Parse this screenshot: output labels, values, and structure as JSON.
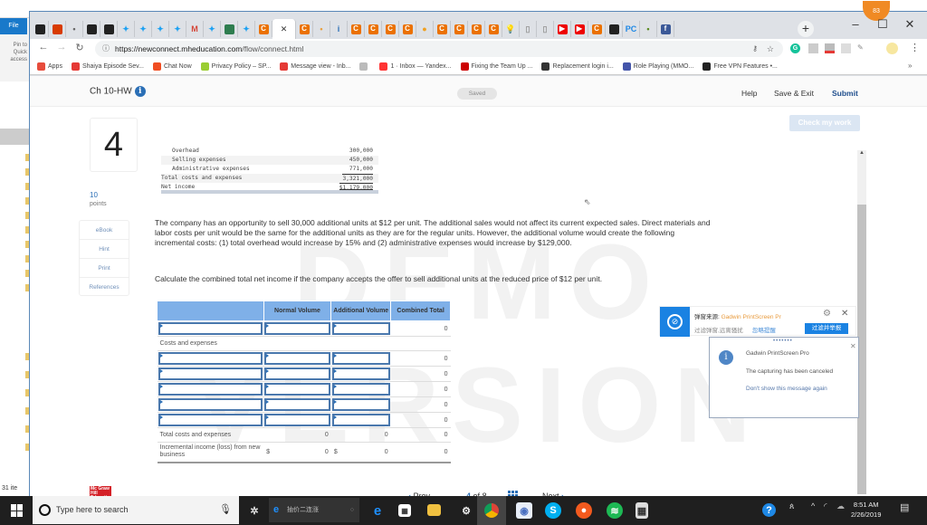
{
  "explorer": {
    "file_tab": "File",
    "pin_label": "Pin to Quick access",
    "item_count": "31 ite"
  },
  "browser": {
    "tabs": [
      {
        "icon": "film-icon",
        "color": "#222"
      },
      {
        "icon": "office-icon",
        "color": "#d83b01"
      },
      {
        "icon": "link-icon",
        "color": "#666"
      },
      {
        "icon": "qr-icon",
        "color": "#222"
      },
      {
        "icon": "tr-icon",
        "color": "#222"
      },
      {
        "icon": "twitter-icon",
        "color": "#1da1f2"
      },
      {
        "icon": "twitter-icon",
        "color": "#1da1f2"
      },
      {
        "icon": "twitter-icon",
        "color": "#1da1f2"
      },
      {
        "icon": "twitter-icon",
        "color": "#1da1f2"
      },
      {
        "icon": "gmail-icon",
        "color": "#d44638"
      },
      {
        "icon": "twitter-icon",
        "color": "#1da1f2"
      },
      {
        "icon": "green-box-icon",
        "color": "#2e7d4f"
      },
      {
        "icon": "twitter-icon",
        "color": "#1da1f2"
      },
      {
        "icon": "chegg-icon",
        "color": "#eb7100"
      },
      {
        "icon": "close-icon",
        "color": "#333",
        "active": true
      },
      {
        "icon": "chegg-icon",
        "color": "#eb7100"
      },
      {
        "icon": "dots-icon",
        "color": "#e8a040"
      },
      {
        "icon": "info-i-icon",
        "color": "#2b6fb6"
      },
      {
        "icon": "chegg-icon",
        "color": "#eb7100"
      },
      {
        "icon": "chegg-icon",
        "color": "#eb7100"
      },
      {
        "icon": "chegg-icon",
        "color": "#eb7100"
      },
      {
        "icon": "chegg-icon",
        "color": "#eb7100"
      },
      {
        "icon": "circle-icon",
        "color": "#f0a020"
      },
      {
        "icon": "chegg-icon",
        "color": "#eb7100"
      },
      {
        "icon": "chegg-icon",
        "color": "#eb7100"
      },
      {
        "icon": "chegg-icon",
        "color": "#eb7100"
      },
      {
        "icon": "chegg-icon",
        "color": "#eb7100"
      },
      {
        "icon": "bulb-icon",
        "color": "#2aa0e0"
      },
      {
        "icon": "page-icon",
        "color": "#999"
      },
      {
        "icon": "page-icon",
        "color": "#999"
      },
      {
        "icon": "youtube-icon",
        "color": "#e00"
      },
      {
        "icon": "youtube-icon",
        "color": "#e00"
      },
      {
        "icon": "chegg-icon",
        "color": "#eb7100"
      },
      {
        "icon": "ak-icon",
        "color": "#222"
      },
      {
        "icon": "pc-icon",
        "color": "#1e88e5"
      },
      {
        "icon": "bug-icon",
        "color": "#5a8a20"
      },
      {
        "icon": "facebook-icon",
        "color": "#3b5998"
      }
    ],
    "notification_count": "83",
    "url_host": "https://newconnect.mheducation.com",
    "url_path": "/flow/connect.html",
    "bookmarks": [
      {
        "label": "Apps",
        "icon": "apps-grid-icon",
        "color": "#e74c3c"
      },
      {
        "label": "Shaiya Episode Sev...",
        "icon": "b-icon",
        "color": "#e53935"
      },
      {
        "label": "Chat Now",
        "icon": "chat-icon",
        "color": "#f04e23"
      },
      {
        "label": "Privacy Policy – SP...",
        "icon": "spa-icon",
        "color": "#9acd32"
      },
      {
        "label": "Message view - Inb...",
        "icon": "mail-icon",
        "color": "#e53935"
      },
      {
        "label": "",
        "icon": "page-icon",
        "color": "#bbb"
      },
      {
        "label": "1 · Inbox — Yandex...",
        "icon": "yandex-mail-icon",
        "color": "#f33"
      },
      {
        "label": "Fixing the Team Up ...",
        "icon": "v-icon",
        "color": "#c00"
      },
      {
        "label": "Replacement login i...",
        "icon": "gmx-icon",
        "color": "#333"
      },
      {
        "label": "Role Playing (MMO...",
        "icon": "mmo-icon",
        "color": "#4455aa"
      },
      {
        "label": "Free VPN Features •...",
        "icon": "fire-icon",
        "color": "#222"
      }
    ],
    "bookmarks_more": "»"
  },
  "page": {
    "assignment_title": "Ch 10-HW",
    "saved_label": "Saved",
    "help": "Help",
    "save_exit": "Save & Exit",
    "submit": "Submit",
    "check_work": "Check my work",
    "question_number": "4",
    "points_value": "10",
    "points_label": "points",
    "side_links": [
      "eBook",
      "Hint",
      "Print",
      "References"
    ],
    "statement": [
      {
        "label": "Overhead",
        "value": "300,000",
        "indent": true
      },
      {
        "label": "Selling expenses",
        "value": "450,000",
        "indent": true
      },
      {
        "label": "Administrative expenses",
        "value": "771,000",
        "indent": true
      },
      {
        "label": "Total costs and expenses",
        "value": "3,321,000",
        "indent": false
      },
      {
        "label": "Net income",
        "value": "$1,179,000",
        "indent": false
      }
    ],
    "watermark": "DEMO VERSION",
    "question_text": "The company has an opportunity to sell 30,000 additional units at $12 per unit. The additional sales would not affect its current expected sales. Direct materials and labor costs per unit would be the same for the additional units as they are for the regular units. However, the additional volume would create the following incremental costs: (1) total overhead would increase by 15% and (2) administrative expenses would increase by $129,000.",
    "instruction": "Calculate the combined total net income if the company accepts the offer to sell additional units at the reduced price of $12 per unit.",
    "table": {
      "headers": [
        "",
        "Normal Volume",
        "Additional Volume",
        "Combined Total"
      ],
      "first_row_total": "0",
      "section_label": "Costs and expenses",
      "expense_totals": [
        "0",
        "0",
        "0",
        "0",
        "0"
      ],
      "total_row": {
        "label": "Total costs and expenses",
        "normal": "0",
        "additional": "0",
        "combined": "0"
      },
      "income_row": {
        "label": "Incremental income (loss) from new business",
        "currency": "$",
        "normal": "0",
        "additional": "0",
        "combined": "0"
      }
    },
    "pager": {
      "prev": "Prev",
      "current": "4",
      "of": "of",
      "total": "8",
      "next": "Next"
    },
    "logo_text": "Mc Graw Hill Education"
  },
  "popup_cn": {
    "source_label": "弹窗来源:",
    "source_app": "Gadwin PrintScreen Pr",
    "desc": "过滤弹窗,远离骚扰",
    "ignore_link": "忽略提醒",
    "report_button": "过滤并举报"
  },
  "popup_gadwin": {
    "app": "Gadwin PrintScreen Pro",
    "message": "The capturing has been canceled",
    "dont_show": "Don't show this message again"
  },
  "taskbar": {
    "search_placeholder": "Type here to search",
    "edge_search_text": "抽价二连涨",
    "time": "8:51 AM",
    "date": "2/26/2019"
  }
}
